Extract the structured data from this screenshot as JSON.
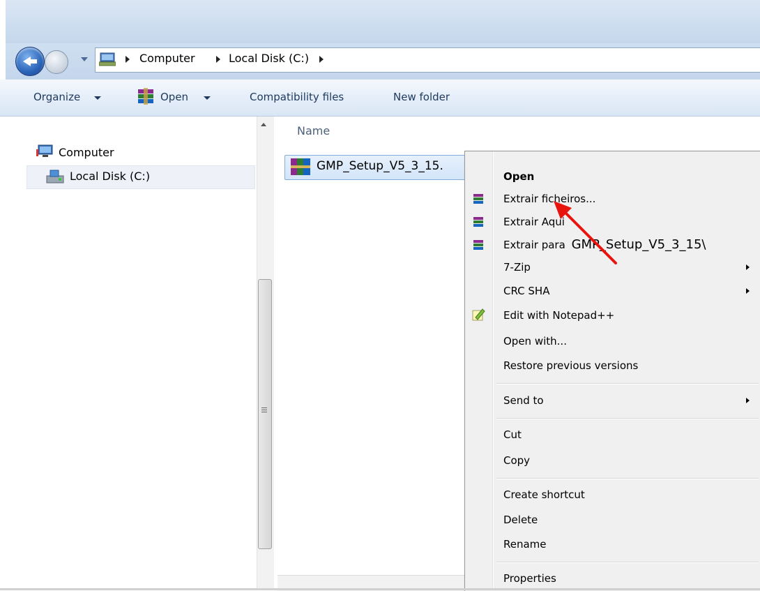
{
  "address_bar": {
    "crumbs": [
      "Computer",
      "Local Disk (C:)"
    ]
  },
  "toolbar": {
    "organize_label": "Organize",
    "open_label": "Open",
    "compatibility_label": "Compatibility files",
    "new_folder_label": "New folder"
  },
  "nav_pane": {
    "computer_label": "Computer",
    "local_disk_label": "Local Disk (C:)"
  },
  "file_list": {
    "column_name": "Name",
    "file_name": "GMP_Setup_V5_3_15."
  },
  "context_menu": {
    "open": "Open",
    "extrair_ficheiros": "Extrair ficheiros...",
    "extrair_aqui": "Extrair Aqui",
    "extrair_para_label": "Extrair para",
    "extrair_para_target": "GMP_Setup_V5_3_15\\",
    "seven_zip": "7-Zip",
    "crc_sha": "CRC SHA",
    "edit_notepad": "Edit with Notepad++",
    "open_with": "Open with...",
    "restore_versions": "Restore previous versions",
    "send_to": "Send to",
    "cut": "Cut",
    "copy": "Copy",
    "create_shortcut": "Create shortcut",
    "delete": "Delete",
    "rename": "Rename",
    "properties": "Properties"
  },
  "colors": {
    "annotation_arrow": "#e8140e",
    "toolbar_text": "#1e395b",
    "selection_border": "#84acdd"
  }
}
